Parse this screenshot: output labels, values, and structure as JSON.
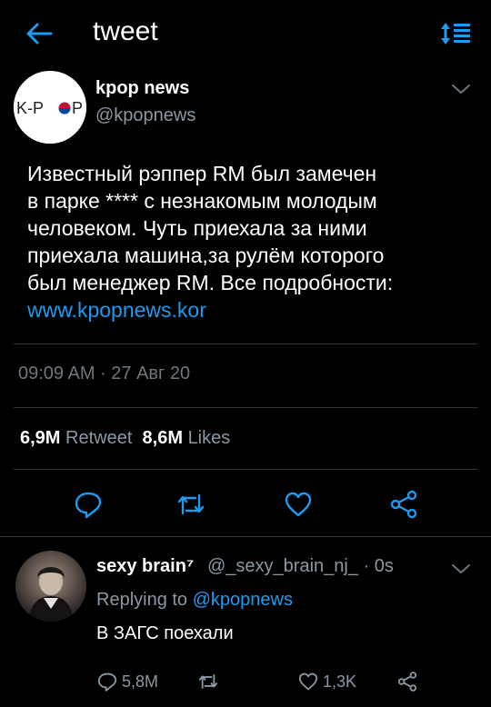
{
  "header": {
    "title": "tweet"
  },
  "tweet": {
    "author_name": "kpop news",
    "author_handle": "@kpopnews",
    "avatar_text": "K-POP",
    "text_lines": [
      "Известный рэппер RM был замечен",
      "в парке **** с незнакомым молодым",
      "человеком. Чуть приехала за ними",
      "приехала машина,за рулём которого",
      "был менеджер RM. Все подробности:"
    ],
    "link": "www.kpopnews.kor",
    "timestamp": "09:09 AM · 27 Авг 20",
    "retweets_count": "6,9M",
    "retweets_label": "Retweet",
    "likes_count": "8,6M",
    "likes_label": "Likes"
  },
  "reply": {
    "name": "sexy brain⁷",
    "handle": "@_sexy_brain_nj_ · 0s",
    "replying_prefix": "Replying to",
    "replying_mention": "@kpopnews",
    "text": "В ЗАГС поехали",
    "reply_count": "5,8M",
    "like_count": "1,3K"
  },
  "colors": {
    "accent": "#1d9bf0",
    "muted": "#8b98a5",
    "background": "#000000"
  },
  "icons": [
    "back-arrow-icon",
    "sort-icon",
    "chevron-down-icon",
    "reply-icon",
    "retweet-icon",
    "like-icon",
    "share-icon"
  ]
}
